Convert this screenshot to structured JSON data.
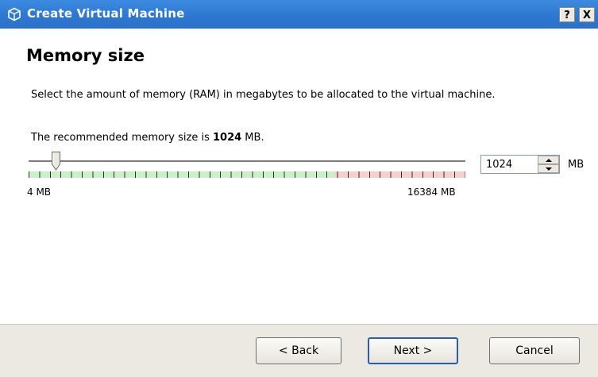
{
  "window": {
    "title": "Create Virtual Machine",
    "help_label": "?",
    "close_label": "X",
    "titlebar_color": "#2d78d2"
  },
  "page": {
    "title": "Memory size",
    "description": "Select the amount of memory (RAM) in megabytes to be allocated to the virtual machine.",
    "recommended_prefix": "The recommended memory size is ",
    "recommended_value": "1024",
    "recommended_suffix": " MB."
  },
  "memory_slider": {
    "min_label": "4 MB",
    "max_label": "16384 MB",
    "min": 4,
    "max": 16384,
    "value": 1024,
    "safe_fraction": 0.7,
    "safe_color": "#c9f0c7",
    "danger_color": "#f7cfcf"
  },
  "memory_input": {
    "value": "1024",
    "unit": "MB"
  },
  "buttons": {
    "back": "< Back",
    "next": "Next >",
    "cancel": "Cancel"
  }
}
